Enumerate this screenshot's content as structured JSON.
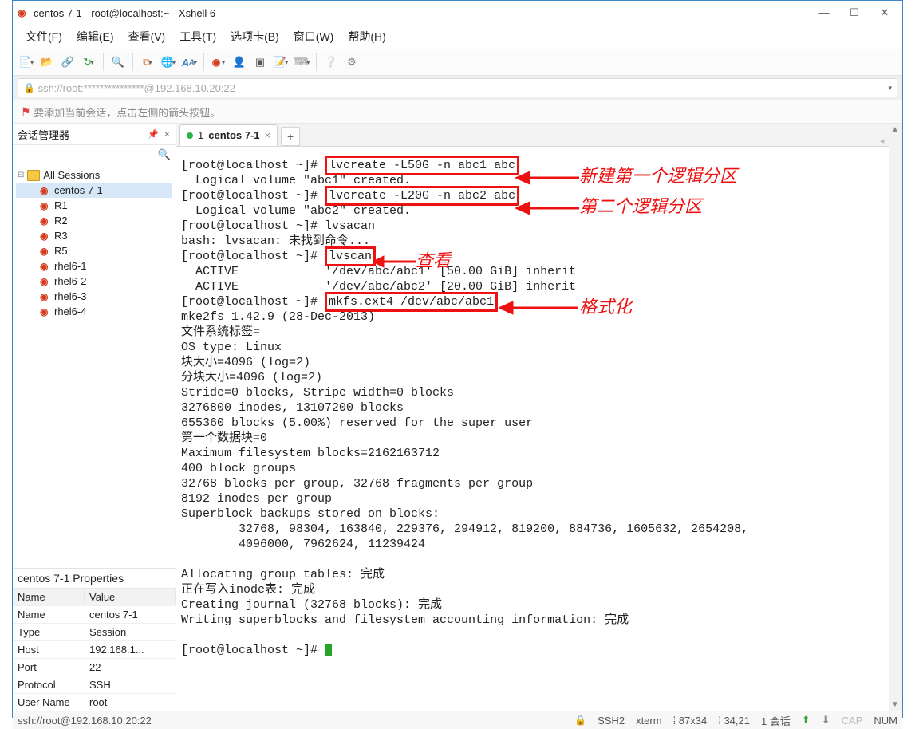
{
  "window": {
    "title": "centos 7-1 - root@localhost:~ - Xshell 6"
  },
  "menu": [
    "文件(F)",
    "编辑(E)",
    "查看(V)",
    "工具(T)",
    "选项卡(B)",
    "窗口(W)",
    "帮助(H)"
  ],
  "addressbar": {
    "text": "ssh://root:***************@192.168.10.20:22"
  },
  "banner": {
    "text": "要添加当前会话，点击左侧的箭头按钮。"
  },
  "sidebar": {
    "title": "会话管理器",
    "root": "All Sessions",
    "items": [
      "centos 7-1",
      "R1",
      "R2",
      "R3",
      "R5",
      "rhel6-1",
      "rhel6-2",
      "rhel6-3",
      "rhel6-4"
    ]
  },
  "props": {
    "title": "centos 7-1 Properties",
    "headers": [
      "Name",
      "Value"
    ],
    "rows": [
      [
        "Name",
        "centos 7-1"
      ],
      [
        "Type",
        "Session"
      ],
      [
        "Host",
        "192.168.1..."
      ],
      [
        "Port",
        "22"
      ],
      [
        "Protocol",
        "SSH"
      ],
      [
        "User Name",
        "root"
      ]
    ]
  },
  "tab": {
    "index": "1",
    "label": "centos 7-1"
  },
  "term": {
    "prompt": "[root@localhost ~]# ",
    "cmd1": "lvcreate -L50G -n abc1 abc",
    "out1": "  Logical volume \"abc1\" created.",
    "cmd2": "lvcreate -L20G -n abc2 abc",
    "out2": "  Logical volume \"abc2\" created.",
    "cmd3": "lvsacan",
    "out3": "bash: lvsacan: 未找到命令...",
    "cmd4": "lvscan",
    "out4a": "  ACTIVE            '/dev/abc/abc1' [50.00 GiB] inherit",
    "out4b": "  ACTIVE            '/dev/abc/abc2' [20.00 GiB] inherit",
    "cmd5": "mkfs.ext4 /dev/abc/abc1",
    "rest": "mke2fs 1.42.9 (28-Dec-2013)\n文件系统标签=\nOS type: Linux\n块大小=4096 (log=2)\n分块大小=4096 (log=2)\nStride=0 blocks, Stripe width=0 blocks\n3276800 inodes, 13107200 blocks\n655360 blocks (5.00%) reserved for the super user\n第一个数据块=0\nMaximum filesystem blocks=2162163712\n400 block groups\n32768 blocks per group, 32768 fragments per group\n8192 inodes per group\nSuperblock backups stored on blocks: \n\t32768, 98304, 163840, 229376, 294912, 819200, 884736, 1605632, 2654208, \n\t4096000, 7962624, 11239424\n\nAllocating group tables: 完成                            \n正在写入inode表: 完成                            \nCreating journal (32768 blocks): 完成\nWriting superblocks and filesystem accounting information: 完成   \n"
  },
  "annotations": {
    "a1": "新建第一个逻辑分区",
    "a2": "第二个逻辑分区",
    "a3": "查看",
    "a4": "格式化"
  },
  "status": {
    "left": "ssh://root@192.168.10.20:22",
    "ssh": "SSH2",
    "term": "xterm",
    "size": "87x34",
    "pos": "34,21",
    "sess": "1 会话",
    "cap": "CAP",
    "num": "NUM"
  }
}
